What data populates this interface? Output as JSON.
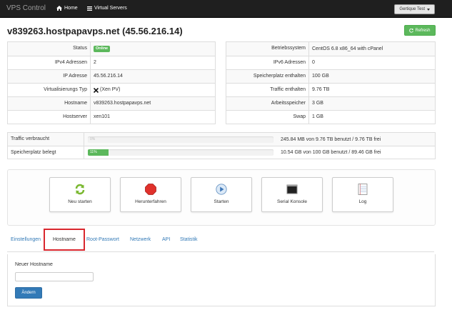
{
  "navbar": {
    "brand": "VPS Control",
    "home_label": "Home",
    "servers_label": "Virtual Servers",
    "user_label": "Gertique Test"
  },
  "page": {
    "title": "v839263.hostpapavps.net (45.56.216.14)",
    "refresh_label": "Refresh"
  },
  "left_info": [
    {
      "key": "Status",
      "value": "Online"
    },
    {
      "key": "IPv4 Adressen",
      "value": "2"
    },
    {
      "key": "IP Adresse",
      "value": "45.56.216.14"
    },
    {
      "key": "Virtualisierungs Typ",
      "value": "(Xen PV)"
    },
    {
      "key": "Hostname",
      "value": "v839263.hostpapavps.net"
    },
    {
      "key": "Hostserver",
      "value": "xen101"
    }
  ],
  "right_info": [
    {
      "key": "Betriebssystem",
      "value": "CentOS 6.8 x86_64 with cPanel"
    },
    {
      "key": "IPv6 Adressen",
      "value": "0"
    },
    {
      "key": "Speicherplatz enthalten",
      "value": "100 GB"
    },
    {
      "key": "Traffic enthalten",
      "value": "9.76 TB"
    },
    {
      "key": "Arbeitsspeicher",
      "value": "3 GB"
    },
    {
      "key": "Swap",
      "value": "1 GB"
    }
  ],
  "usage": [
    {
      "label": "Traffic verbraucht",
      "percent_label": "0%",
      "fill_fraction": 0.0,
      "text": "245.84 MB von 9.76 TB benutzt / 9.76 TB frei"
    },
    {
      "label": "Speicherplatz belegt",
      "percent_label": "11%",
      "fill_fraction": 0.11,
      "text": "10.54 GB von 100 GB benutzt / 89.46 GB frei"
    }
  ],
  "actions": [
    {
      "label": "Neu starten",
      "icon": "restart-icon"
    },
    {
      "label": "Herunterfahren",
      "icon": "stop-icon"
    },
    {
      "label": "Starten",
      "icon": "play-icon"
    },
    {
      "label": "Serial Konsole",
      "icon": "console-icon"
    },
    {
      "label": "Log",
      "icon": "log-icon"
    }
  ],
  "tabs": [
    {
      "label": "Einstellungen"
    },
    {
      "label": "Hostname"
    },
    {
      "label": "Root-Passwort"
    },
    {
      "label": "Netzwerk"
    },
    {
      "label": "API"
    },
    {
      "label": "Statistik"
    }
  ],
  "hostname_form": {
    "label": "Neuer Hostname",
    "input_value": "",
    "submit_label": "Ändern"
  },
  "colors": {
    "navbar": "#1f1f1f",
    "success": "#5cb85c",
    "primary": "#337ab7",
    "danger": "#d9272e"
  }
}
